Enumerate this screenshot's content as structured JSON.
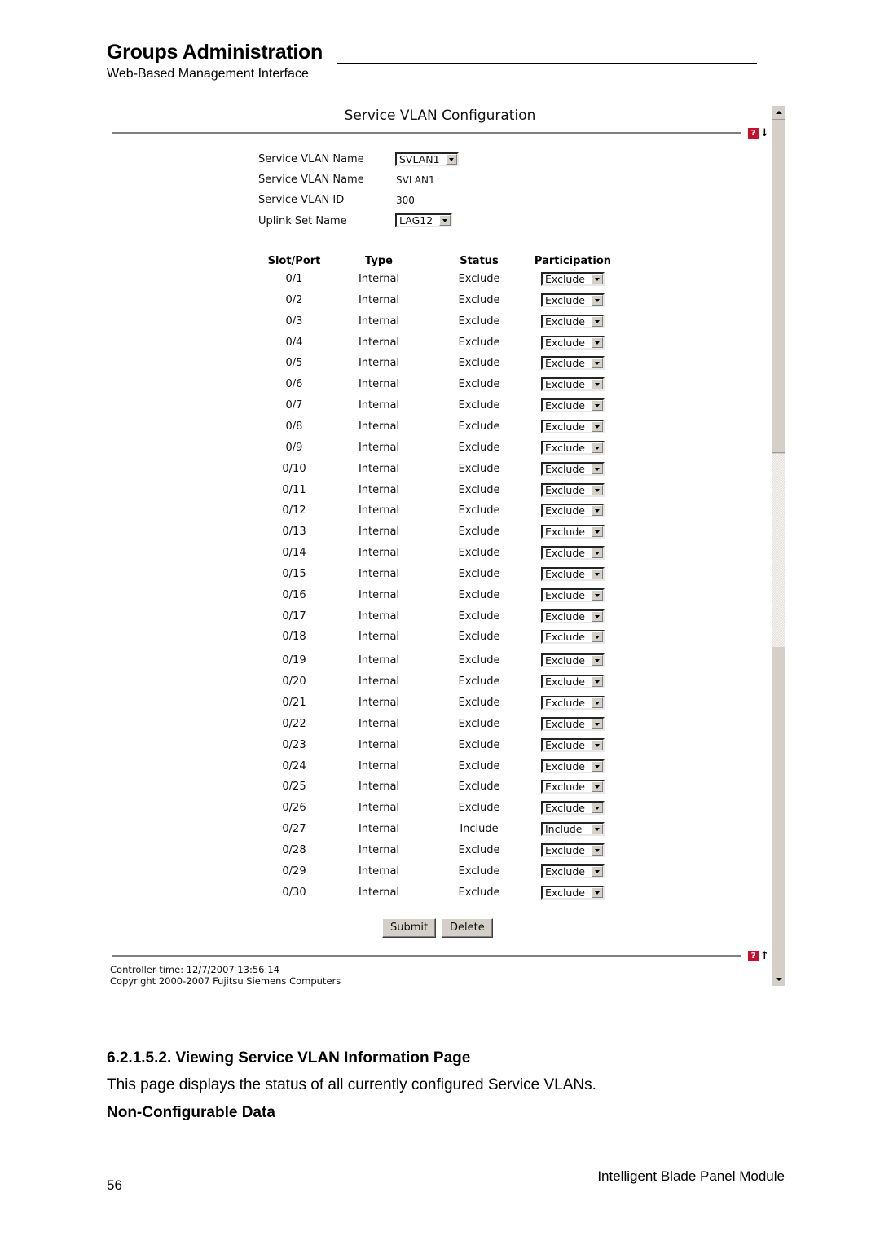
{
  "document": {
    "title": "Groups Administration",
    "subtitle": "Web-Based Management Interface",
    "section_heading": "6.2.1.5.2. Viewing Service VLAN Information Page",
    "body_text": "This page displays the status of all currently configured Service VLANs.",
    "sub_heading": "Non-Configurable Data",
    "page_number": "56",
    "footer_title": "Intelligent Blade Panel Module"
  },
  "panel": {
    "title": "Service VLAN Configuration",
    "help_icon": "help-icon",
    "help_glyph": "?",
    "down_arrow": "↓",
    "up_arrow": "↑",
    "form": {
      "svlan_name_select_label": "Service VLAN Name",
      "svlan_name_select_value": "SVLAN1",
      "svlan_name_label": "Service VLAN Name",
      "svlan_name_value": "SVLAN1",
      "svlan_id_label": "Service VLAN ID",
      "svlan_id_value": "300",
      "uplink_set_label": "Uplink Set Name",
      "uplink_set_value": "LAG12"
    },
    "table": {
      "headers": [
        "Slot/Port",
        "Type",
        "Status",
        "Participation"
      ],
      "rows": [
        {
          "port": "0/1",
          "type": "Internal",
          "status": "Exclude",
          "participation": "Exclude"
        },
        {
          "port": "0/2",
          "type": "Internal",
          "status": "Exclude",
          "participation": "Exclude"
        },
        {
          "port": "0/3",
          "type": "Internal",
          "status": "Exclude",
          "participation": "Exclude"
        },
        {
          "port": "0/4",
          "type": "Internal",
          "status": "Exclude",
          "participation": "Exclude"
        },
        {
          "port": "0/5",
          "type": "Internal",
          "status": "Exclude",
          "participation": "Exclude"
        },
        {
          "port": "0/6",
          "type": "Internal",
          "status": "Exclude",
          "participation": "Exclude"
        },
        {
          "port": "0/7",
          "type": "Internal",
          "status": "Exclude",
          "participation": "Exclude"
        },
        {
          "port": "0/8",
          "type": "Internal",
          "status": "Exclude",
          "participation": "Exclude"
        },
        {
          "port": "0/9",
          "type": "Internal",
          "status": "Exclude",
          "participation": "Exclude"
        },
        {
          "port": "0/10",
          "type": "Internal",
          "status": "Exclude",
          "participation": "Exclude"
        },
        {
          "port": "0/11",
          "type": "Internal",
          "status": "Exclude",
          "participation": "Exclude"
        },
        {
          "port": "0/12",
          "type": "Internal",
          "status": "Exclude",
          "participation": "Exclude"
        },
        {
          "port": "0/13",
          "type": "Internal",
          "status": "Exclude",
          "participation": "Exclude"
        },
        {
          "port": "0/14",
          "type": "Internal",
          "status": "Exclude",
          "participation": "Exclude"
        },
        {
          "port": "0/15",
          "type": "Internal",
          "status": "Exclude",
          "participation": "Exclude"
        },
        {
          "port": "0/16",
          "type": "Internal",
          "status": "Exclude",
          "participation": "Exclude"
        },
        {
          "port": "0/17",
          "type": "Internal",
          "status": "Exclude",
          "participation": "Exclude"
        },
        {
          "port": "0/18",
          "type": "Internal",
          "status": "Exclude",
          "participation": "Exclude"
        },
        {
          "port": "0/19",
          "type": "Internal",
          "status": "Exclude",
          "participation": "Exclude"
        },
        {
          "port": "0/20",
          "type": "Internal",
          "status": "Exclude",
          "participation": "Exclude"
        },
        {
          "port": "0/21",
          "type": "Internal",
          "status": "Exclude",
          "participation": "Exclude"
        },
        {
          "port": "0/22",
          "type": "Internal",
          "status": "Exclude",
          "participation": "Exclude"
        },
        {
          "port": "0/23",
          "type": "Internal",
          "status": "Exclude",
          "participation": "Exclude"
        },
        {
          "port": "0/24",
          "type": "Internal",
          "status": "Exclude",
          "participation": "Exclude"
        },
        {
          "port": "0/25",
          "type": "Internal",
          "status": "Exclude",
          "participation": "Exclude"
        },
        {
          "port": "0/26",
          "type": "Internal",
          "status": "Exclude",
          "participation": "Exclude"
        },
        {
          "port": "0/27",
          "type": "Internal",
          "status": "Include",
          "participation": "Include"
        },
        {
          "port": "0/28",
          "type": "Internal",
          "status": "Exclude",
          "participation": "Exclude"
        },
        {
          "port": "0/29",
          "type": "Internal",
          "status": "Exclude",
          "participation": "Exclude"
        },
        {
          "port": "0/30",
          "type": "Internal",
          "status": "Exclude",
          "participation": "Exclude"
        }
      ]
    },
    "buttons": {
      "submit": "Submit",
      "delete": "Delete"
    },
    "footer": {
      "controller_time": "Controller time: 12/7/2007 13:56:14",
      "copyright": "Copyright 2000-2007 Fujitsu Siemens Computers"
    }
  },
  "colors": {
    "help_icon_bg": "#c8102e",
    "rule_gray": "#808080",
    "button_face": "#d4d0c8"
  }
}
